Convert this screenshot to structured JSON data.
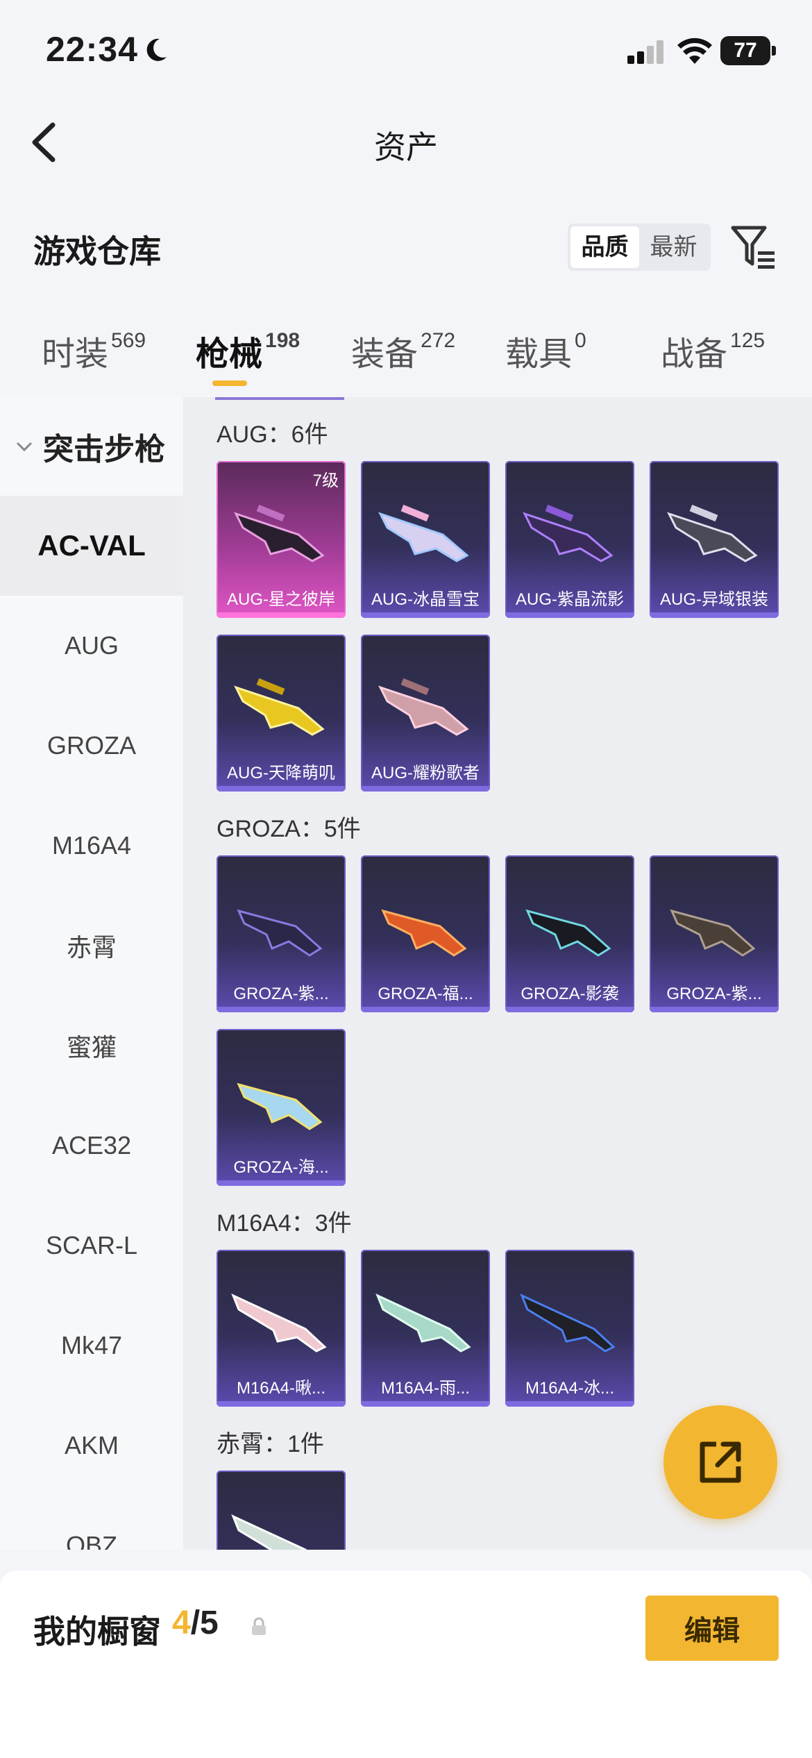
{
  "status_bar": {
    "time": "22:34",
    "battery": "77"
  },
  "nav": {
    "title": "资产"
  },
  "section": {
    "title": "游戏仓库",
    "sort_options": [
      "品质",
      "最新"
    ],
    "sort_active": "品质"
  },
  "tabs": [
    {
      "label": "时装",
      "count": "569"
    },
    {
      "label": "枪械",
      "count": "198"
    },
    {
      "label": "装备",
      "count": "272"
    },
    {
      "label": "载具",
      "count": "0"
    },
    {
      "label": "战备",
      "count": "125"
    }
  ],
  "active_tab": "枪械",
  "sidebar": {
    "group": "突击步枪",
    "items": [
      "AC-VAL",
      "AUG",
      "GROZA",
      "M16A4",
      "赤霄",
      "蜜獾",
      "ACE32",
      "SCAR-L",
      "Mk47",
      "AKM",
      "QBZ"
    ],
    "active": "AC-VAL"
  },
  "groups": [
    {
      "title": "AUG：6件",
      "items": [
        {
          "name": "AUG-星之彼岸",
          "level": "7级",
          "rarity": "legend"
        },
        {
          "name": "AUG-冰晶雪宝"
        },
        {
          "name": "AUG-紫晶流影"
        },
        {
          "name": "AUG-异域银装"
        },
        {
          "name": "AUG-天降萌叽"
        },
        {
          "name": "AUG-耀粉歌者"
        }
      ]
    },
    {
      "title": "GROZA：5件",
      "items": [
        {
          "name": "GROZA-紫..."
        },
        {
          "name": "GROZA-福..."
        },
        {
          "name": "GROZA-影袭"
        },
        {
          "name": "GROZA-紫..."
        },
        {
          "name": "GROZA-海..."
        }
      ]
    },
    {
      "title": "M16A4：3件",
      "items": [
        {
          "name": "M16A4-啾..."
        },
        {
          "name": "M16A4-雨..."
        },
        {
          "name": "M16A4-冰..."
        }
      ]
    },
    {
      "title": "赤霄：1件",
      "items": [
        {
          "name": ""
        }
      ]
    }
  ],
  "showcase": {
    "title": "我的橱窗",
    "current": "4",
    "total": "/5",
    "edit_label": "编辑"
  },
  "colors": {
    "accent": "#f2b630",
    "card_purple": "#5d4bb0",
    "card_legend": "#e156c6"
  },
  "icons": [
    "moon-icon",
    "signal-icon",
    "wifi-icon",
    "battery-icon",
    "back-icon",
    "filter-icon",
    "chevron-down-icon",
    "share-icon",
    "lock-icon"
  ]
}
